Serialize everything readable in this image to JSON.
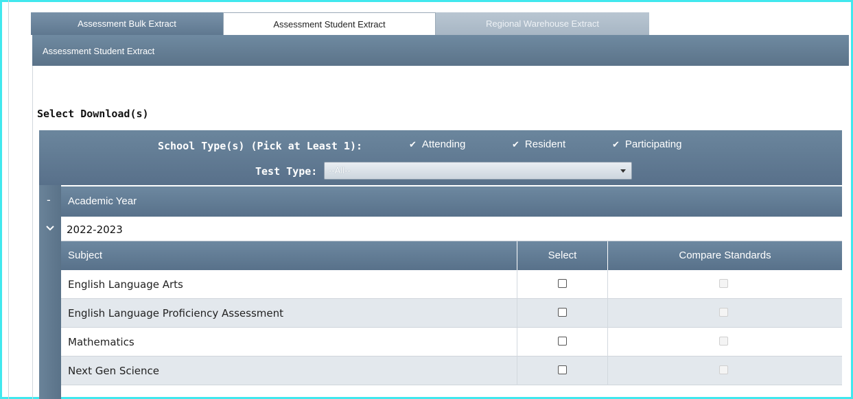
{
  "tabs": [
    {
      "label": "Assessment Bulk Extract",
      "state": "inactive"
    },
    {
      "label": "Assessment Student Extract",
      "state": "active"
    },
    {
      "label": "Regional Warehouse Extract",
      "state": "disabled"
    }
  ],
  "section_header": "Assessment Student Extract",
  "select_downloads_title": "Select Download(s)",
  "school_types": {
    "label": "School Type(s) (Pick at Least 1):",
    "options": [
      {
        "label": "Attending",
        "checked": true
      },
      {
        "label": "Resident",
        "checked": true
      },
      {
        "label": "Participating",
        "checked": true
      }
    ]
  },
  "test_type": {
    "label": "Test Type:",
    "value": "--All--"
  },
  "academic_year": {
    "header": "Academic Year",
    "collapse_glyph": "-",
    "year": "2022-2023"
  },
  "table": {
    "columns": [
      "Subject",
      "Select",
      "Compare Standards"
    ],
    "rows": [
      {
        "subject": "English Language Arts",
        "select": false,
        "compare_enabled": false
      },
      {
        "subject": "English Language Proficiency Assessment",
        "select": false,
        "compare_enabled": false
      },
      {
        "subject": "Mathematics",
        "select": false,
        "compare_enabled": false
      },
      {
        "subject": "Next Gen Science",
        "select": false,
        "compare_enabled": false
      }
    ]
  },
  "colors": {
    "highlight_border": "#41e8ee",
    "header_blue": "#5f7890"
  },
  "icons": {
    "check": "checkmark-icon",
    "chevron": "chevron-down-icon",
    "dropdown": "dropdown-arrow-icon"
  }
}
